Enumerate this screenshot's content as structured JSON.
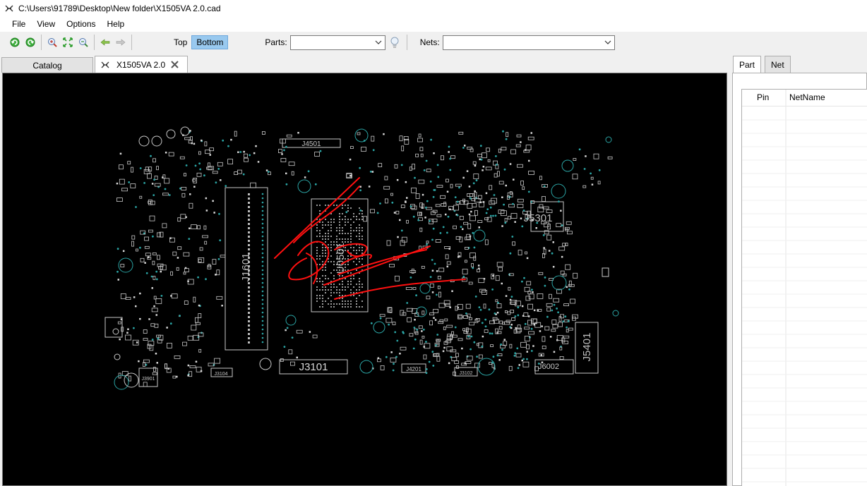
{
  "window": {
    "title": "C:\\Users\\91789\\Desktop\\New folder\\X1505VA 2.0.cad"
  },
  "menu": {
    "items": [
      "File",
      "View",
      "Options",
      "Help"
    ]
  },
  "toolbar": {
    "icons": [
      "rotate-left-icon",
      "rotate-right-icon",
      "zoom-in-icon",
      "fit-icon",
      "zoom-out-icon",
      "back-icon",
      "forward-icon"
    ],
    "top_label": "Top",
    "bottom_label": "Bottom",
    "active_side": "Bottom",
    "parts_label": "Parts:",
    "parts_value": "",
    "nets_label": "Nets:",
    "nets_value": ""
  },
  "doc_tabs": {
    "catalog_label": "Catalog",
    "file_tab_label": "X1505VA 2.0"
  },
  "board": {
    "labels": [
      "J4501",
      "J5301",
      "J1601",
      "U0501",
      "J3101",
      "J4201",
      "J3102",
      "J6002",
      "J5401",
      "J3104",
      "J3901"
    ]
  },
  "right_panel": {
    "tabs": [
      "Part",
      "Net"
    ],
    "active_tab": "Part",
    "columns": [
      "Pin",
      "NetName"
    ],
    "rows": []
  },
  "colors": {
    "board_background": "#000000",
    "trace_outline": "#c8c8c8",
    "via_teal": "#2aa3a3",
    "annotation_red": "#ff1010",
    "active_button": "#99c9ef"
  }
}
